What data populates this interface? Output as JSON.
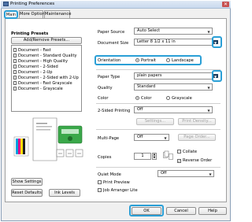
{
  "window": {
    "title": "Printing Preferences",
    "close_glyph": "✕"
  },
  "tabs": [
    {
      "label": "Main"
    },
    {
      "label": "More Options"
    },
    {
      "label": "Maintenance"
    }
  ],
  "presets": {
    "heading": "Printing Presets",
    "add_remove": "Add/Remove Presets...",
    "items": [
      "Document - Fast",
      "Document - Standard Quality",
      "Document - High Quality",
      "Document - 2-Sided",
      "Document - 2-Up",
      "Document - 2-Sided with 2-Up",
      "Document - Fast Grayscale",
      "Document - Grayscale"
    ]
  },
  "settings": {
    "paper_source_label": "Paper Source",
    "paper_source_value": "Auto Select",
    "document_size_label": "Document Size",
    "document_size_value": "Letter 8 1/2 x 11 in",
    "orientation_label": "Orientation",
    "portrait": "Portrait",
    "landscape": "Landscape",
    "paper_type_label": "Paper Type",
    "paper_type_value": "plain papers",
    "quality_label": "Quality",
    "quality_value": "Standard",
    "color_label": "Color",
    "color_option": "Color",
    "grayscale_option": "Grayscale",
    "two_sided_label": "2-Sided Printing",
    "two_sided_value": "Off",
    "settings_btn": "Settings...",
    "print_density_btn": "Print Density...",
    "multi_page_label": "Multi-Page",
    "multi_page_value": "Off",
    "page_order_btn": "Page Order...",
    "copies_label": "Copies",
    "copies_value": "1",
    "collate": "Collate",
    "reverse_order": "Reverse Order",
    "quiet_mode_label": "Quiet Mode",
    "quiet_mode_value": "Off",
    "print_preview": "Print Preview",
    "job_arranger": "Job Arranger Lite"
  },
  "left_buttons": {
    "show_settings": "Show Settings",
    "reset_defaults": "Reset Defaults",
    "ink_levels": "Ink Levels"
  },
  "footer": {
    "ok": "OK",
    "cancel": "Cancel",
    "help": "Help"
  },
  "colors": {
    "highlight": "#2a9fd6",
    "dark_arrow": "#1c3d5e",
    "printer_green": "#3aa84a"
  }
}
